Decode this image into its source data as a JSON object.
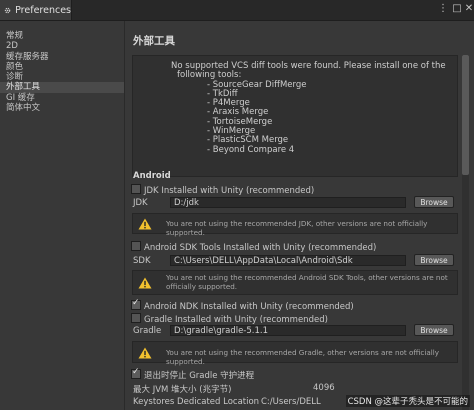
{
  "window": {
    "title": "Preferences"
  },
  "sidebar": {
    "items": [
      "常规",
      "2D",
      "缓存服务器",
      "颜色",
      "诊断",
      "外部工具",
      "GI 缓存",
      "简体中文"
    ],
    "active_index": 5
  },
  "main": {
    "title": "外部工具",
    "vcs_message_lines": [
      "No supported VCS diff tools were found. Please install one of the",
      "following tools:",
      "- SourceGear DiffMerge",
      "- TkDiff",
      "- P4Merge",
      "- Araxis Merge",
      "- TortoiseMerge",
      "- WinMerge",
      "- PlasticSCM Merge",
      "- Beyond Compare 4"
    ],
    "android": {
      "header": "Android",
      "jdk_toggle": "JDK Installed with Unity (recommended)",
      "jdk_label": "JDK",
      "jdk_value": "D:/jdk",
      "jdk_warning": "You are not using the recommended JDK, other versions are not officially supported.",
      "sdk_toggle": "Android SDK Tools Installed with Unity (recommended)",
      "sdk_label": "SDK",
      "sdk_value": "C:\\Users\\DELL\\AppData\\Local\\Android\\Sdk",
      "sdk_warning": "You are not using the recommended Android SDK Tools, other versions are not officially supported.",
      "ndk_toggle": "Android NDK Installed with Unity (recommended)",
      "gradle_toggle": "Gradle Installed with Unity (recommended)",
      "gradle_label": "Gradle",
      "gradle_value": "D:\\gradle\\gradle-5.1.1",
      "gradle_warning": "You are not using the recommended Gradle, other versions are not officially supported.",
      "stop_gradle_toggle": "退出时停止 Gradle 守护进程",
      "jvm_label": "最大 JVM 堆大小 (兆字节)",
      "jvm_value": "4096",
      "keystores_label": "Keystores Dedicated Location",
      "keystores_value": "C:/Users/DELL",
      "browse": "Browse"
    }
  },
  "watermark": "CSDN @这辈子秃头是不可能的",
  "colors": {
    "background": "#383838",
    "warning": "#f2c12e"
  }
}
